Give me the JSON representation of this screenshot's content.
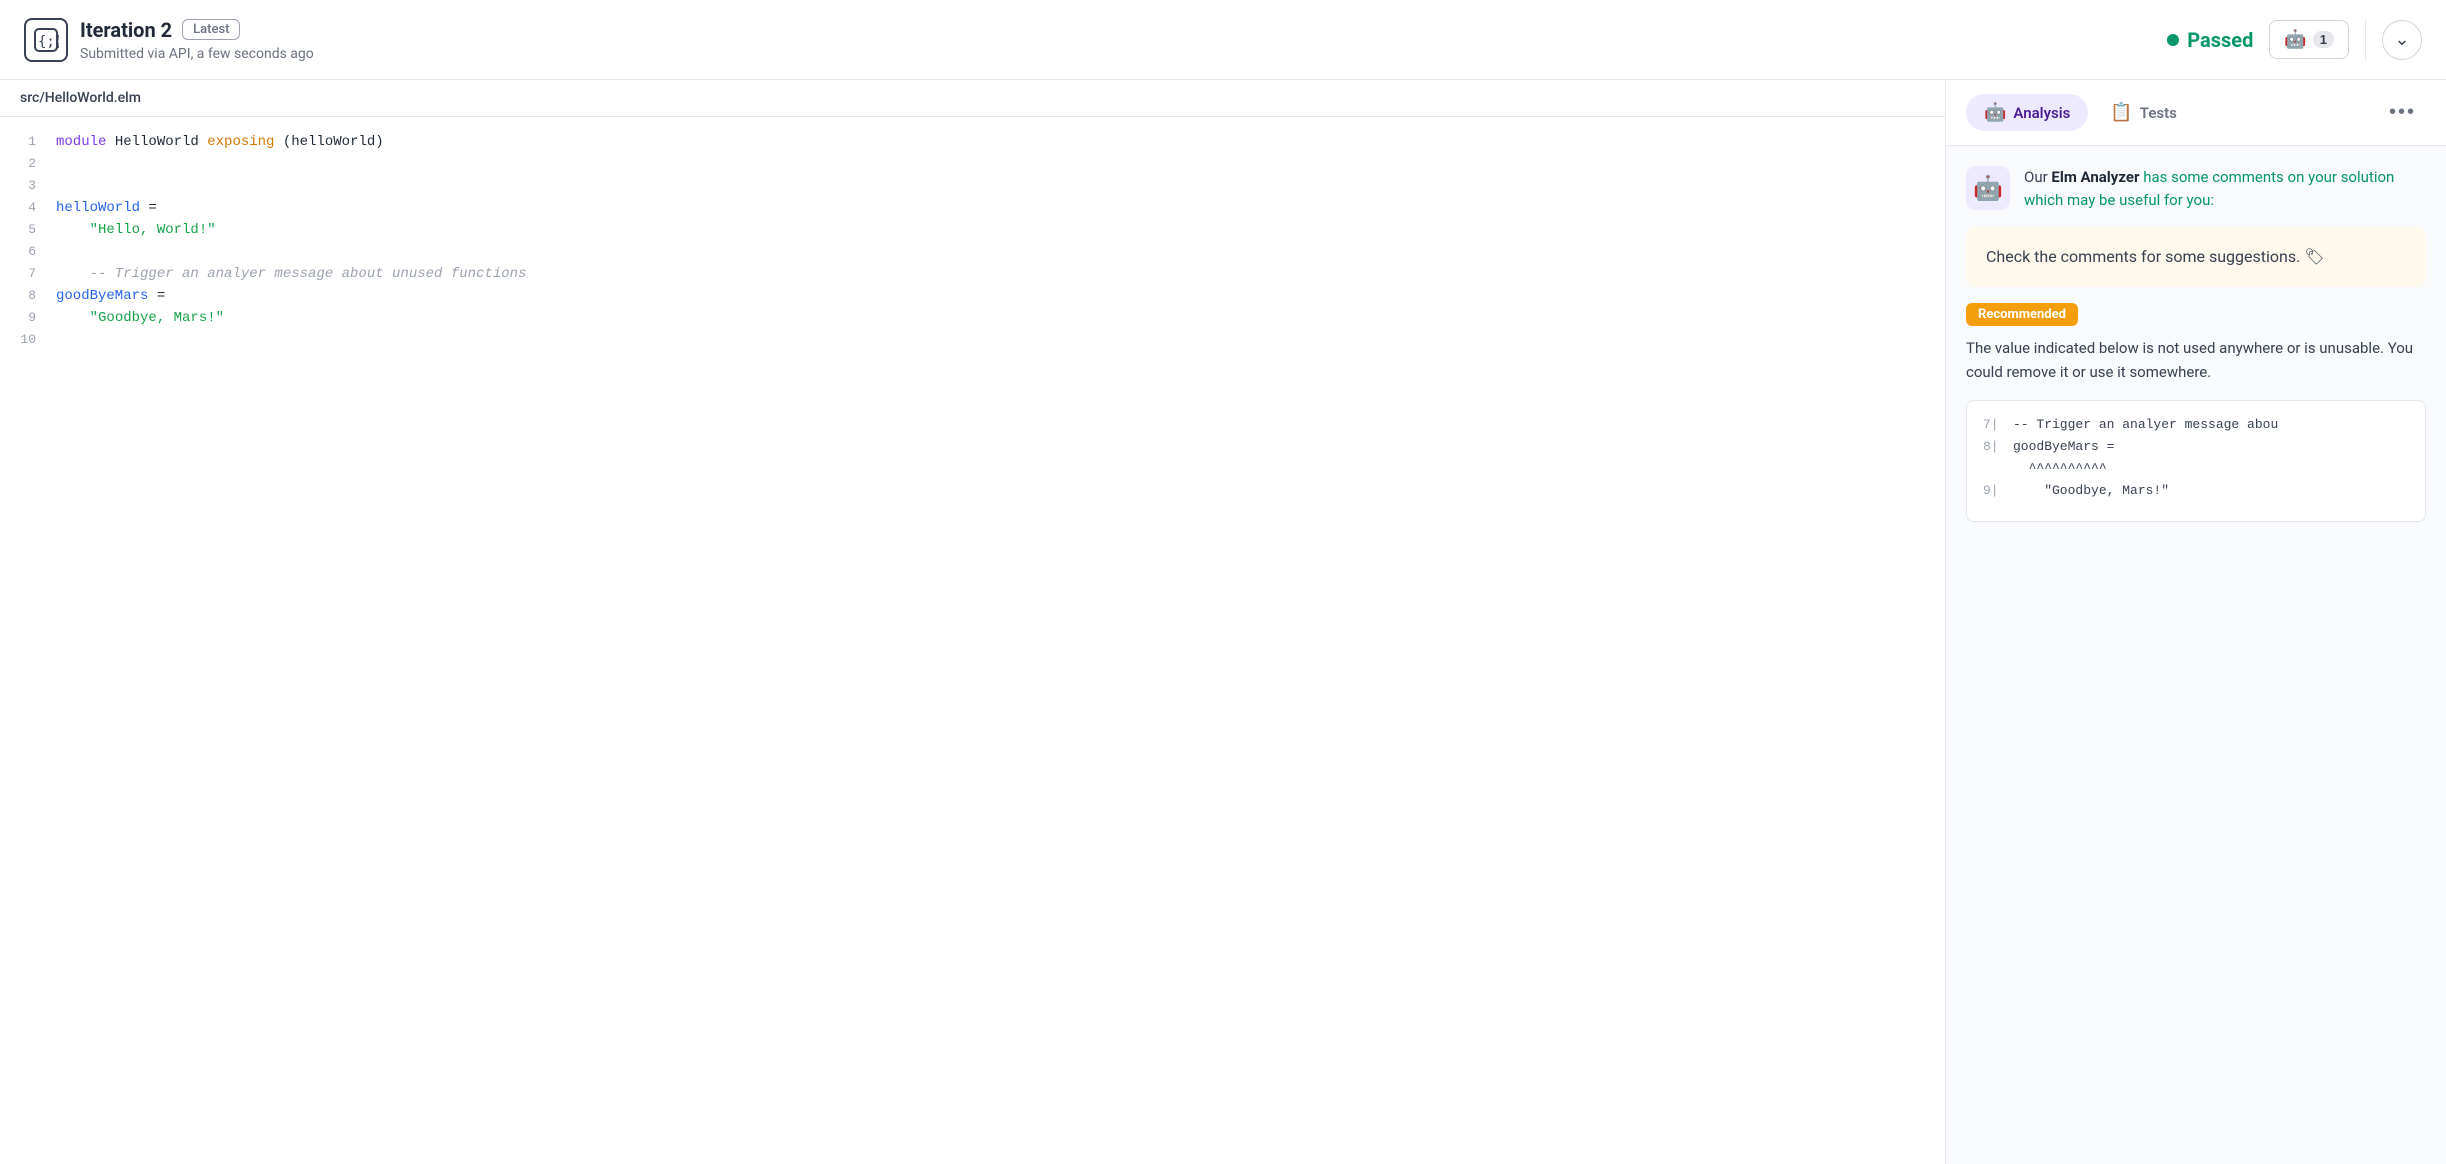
{
  "header": {
    "title": "Iteration 2",
    "badge": "Latest",
    "subtitle": "Submitted via API, a few seconds ago",
    "passed_label": "Passed",
    "mentor_button_label": "1",
    "chevron": "⌄"
  },
  "file_tab": {
    "label": "src/HelloWorld.elm"
  },
  "code": {
    "lines": [
      {
        "number": "1",
        "parts": [
          {
            "text": "module",
            "class": "kw-purple"
          },
          {
            "text": " HelloWorld ",
            "class": "kw-default"
          },
          {
            "text": "exposing",
            "class": "kw-orange"
          },
          {
            "text": " (helloWorld)",
            "class": "kw-default"
          }
        ]
      },
      {
        "number": "2",
        "parts": []
      },
      {
        "number": "3",
        "parts": []
      },
      {
        "number": "4",
        "parts": [
          {
            "text": "helloWorld",
            "class": "kw-blue"
          },
          {
            "text": " =",
            "class": "kw-default"
          }
        ]
      },
      {
        "number": "5",
        "parts": [
          {
            "text": "    ",
            "class": "kw-default"
          },
          {
            "text": "\"Hello, World!\"",
            "class": "kw-green"
          }
        ]
      },
      {
        "number": "6",
        "parts": []
      },
      {
        "number": "7",
        "parts": [
          {
            "text": "    -- Trigger an analyer message about unused functions",
            "class": "kw-comment"
          }
        ]
      },
      {
        "number": "8",
        "parts": [
          {
            "text": "goodByeMars",
            "class": "kw-blue"
          },
          {
            "text": " =",
            "class": "kw-default"
          }
        ]
      },
      {
        "number": "9",
        "parts": [
          {
            "text": "    ",
            "class": "kw-default"
          },
          {
            "text": "\"Goodbye, Mars!\"",
            "class": "kw-green"
          }
        ]
      },
      {
        "number": "10",
        "parts": []
      }
    ]
  },
  "right_panel": {
    "tabs": [
      {
        "label": "Analysis",
        "icon": "🤖",
        "active": true
      },
      {
        "label": "Tests",
        "icon": "📋",
        "active": false
      }
    ],
    "more_label": "•••",
    "analysis": {
      "intro_bold": "Elm Analyzer",
      "intro_green": "has some comments on your solution which may be useful for you:",
      "suggestion_text": "Check the comments for some suggestions. 🏷",
      "recommended_label": "Recommended",
      "description": "The value indicated below is not used anywhere or is unusable. You could remove it or use it somewhere.",
      "snippet_lines": [
        {
          "num": "7|",
          "content": "-- Trigger an analyer message abou"
        },
        {
          "num": "8|",
          "content": "goodByeMars ="
        },
        {
          "num": "",
          "content": "  ^^^^^^^^^^"
        },
        {
          "num": "9|",
          "content": "    \"Goodbye, Mars!\""
        }
      ]
    }
  }
}
